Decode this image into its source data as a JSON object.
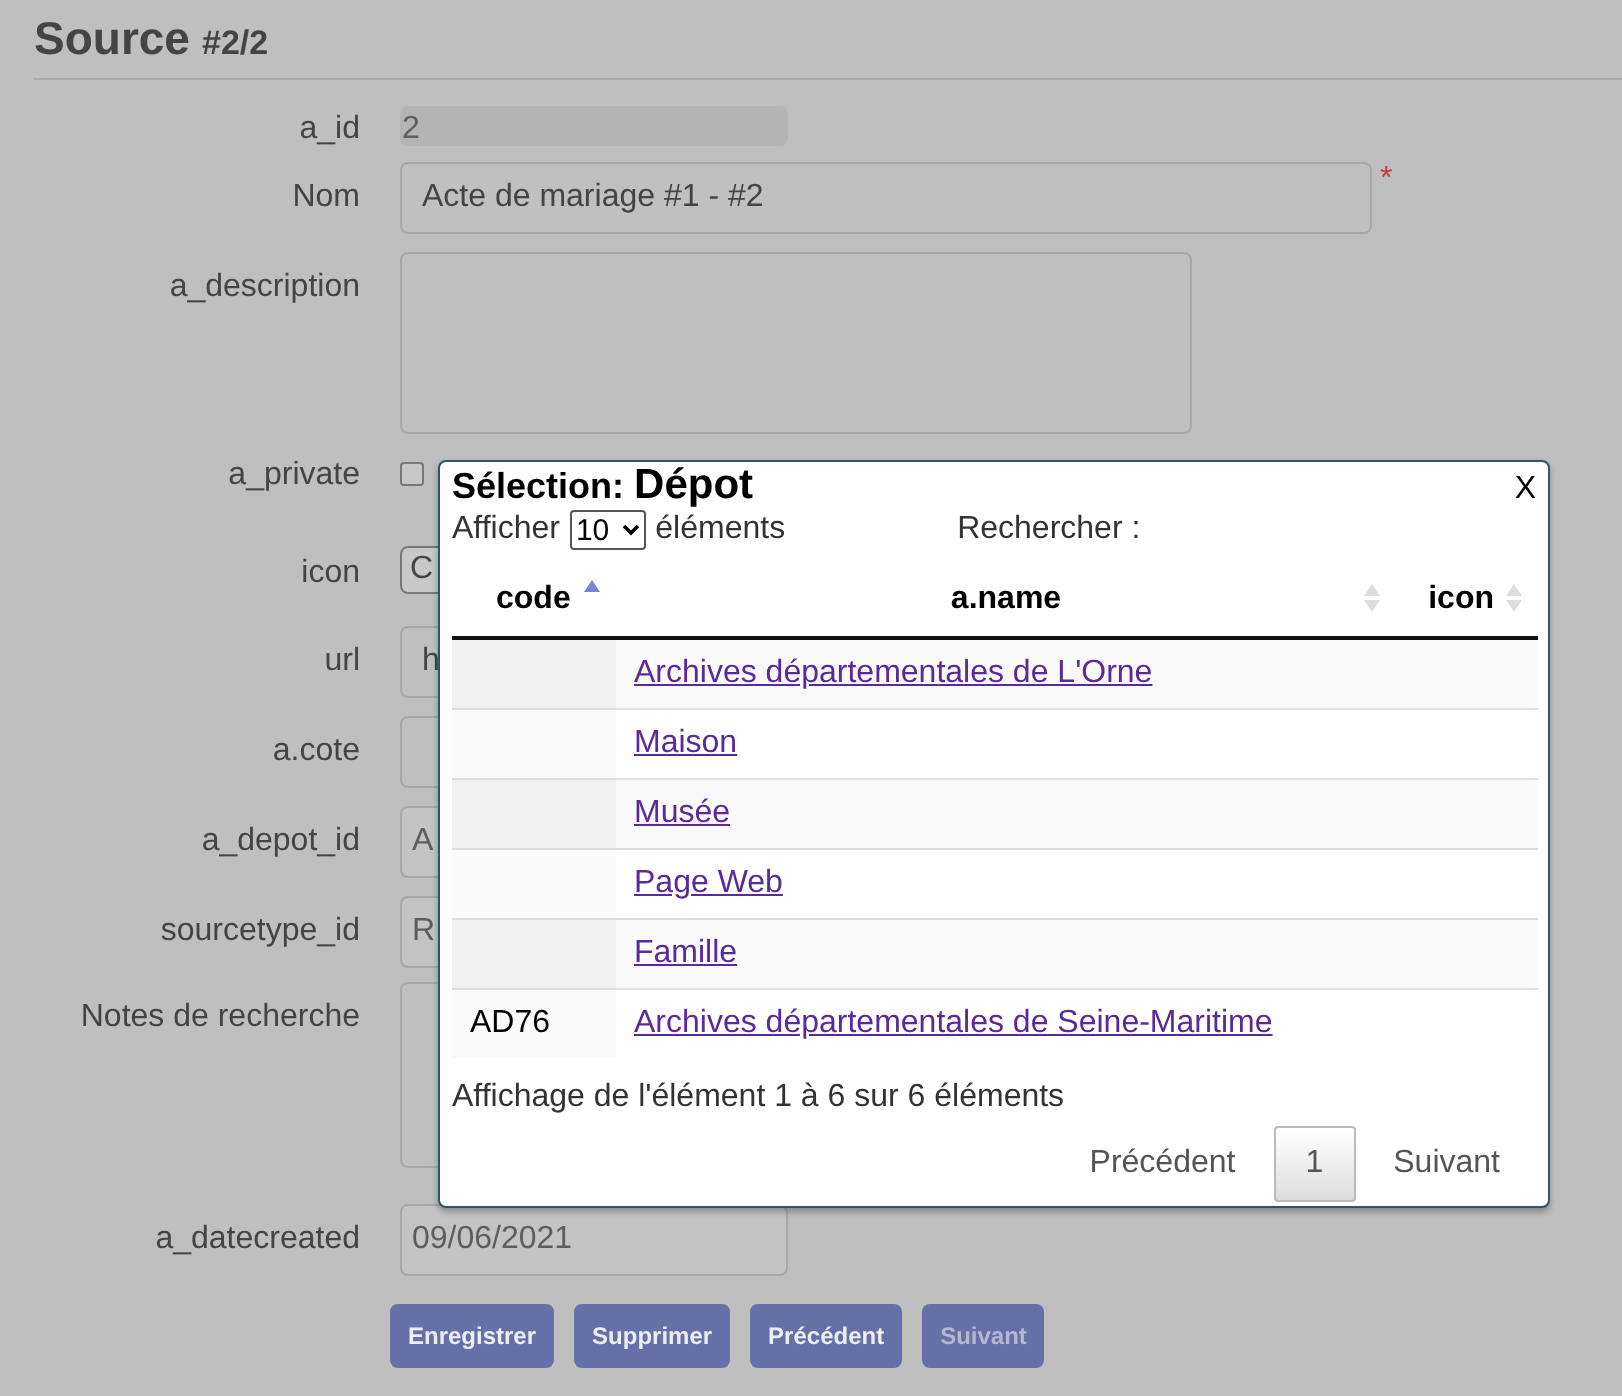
{
  "page": {
    "title": "Source",
    "title_suffix": "#2/2"
  },
  "fields": [
    {
      "label": "a_id",
      "kind": "readonly",
      "value": "2"
    },
    {
      "label": "Nom",
      "kind": "text",
      "value": "Acte de mariage #1 - #2",
      "required_mark": "*"
    },
    {
      "label": "a_description",
      "kind": "textarea"
    },
    {
      "label": "a_private",
      "kind": "checkbox",
      "checked": false
    },
    {
      "label": "icon",
      "kind": "select",
      "value": "C"
    },
    {
      "label": "url",
      "kind": "text",
      "value": "h"
    },
    {
      "label": "a.cote",
      "kind": "text"
    },
    {
      "label": "a_depot_id",
      "kind": "disabled",
      "value": "A"
    },
    {
      "label": "sourcetype_id",
      "kind": "disabled",
      "value": "R"
    },
    {
      "label": "Notes de recherche",
      "kind": "textarea"
    },
    {
      "label": "a_datecreated",
      "kind": "disabled",
      "value": "09/06/2021"
    }
  ],
  "buttons": [
    {
      "label": "Enregistrer",
      "disabled": false
    },
    {
      "label": "Supprimer",
      "disabled": false
    },
    {
      "label": "Précédent",
      "disabled": false
    },
    {
      "label": "Suivant",
      "disabled": true
    }
  ],
  "dialog": {
    "title_prefix": "Sélection:",
    "title": "Dépot",
    "close": "X",
    "length_before": "Afficher",
    "page_length": "10",
    "length_after": "éléments",
    "search_label": "Rechercher :",
    "columns": [
      {
        "label": "code",
        "sorted": true
      },
      {
        "label": "a.name",
        "sorted": false
      },
      {
        "label": "icon",
        "sorted": false
      }
    ],
    "rows": [
      {
        "code": "",
        "name": "Archives départementales de L'Orne"
      },
      {
        "code": "",
        "name": "Maison"
      },
      {
        "code": "",
        "name": "Musée"
      },
      {
        "code": "",
        "name": "Page Web"
      },
      {
        "code": "",
        "name": "Famille"
      },
      {
        "code": "AD76",
        "name": "Archives départementales de Seine-Maritime"
      }
    ],
    "info": "Affichage de l'élément 1 à 6 sur 6 éléments",
    "pagination": {
      "previous": "Précédent",
      "pages": [
        {
          "label": "1",
          "selected": true
        }
      ],
      "next": "Suivant"
    }
  }
}
